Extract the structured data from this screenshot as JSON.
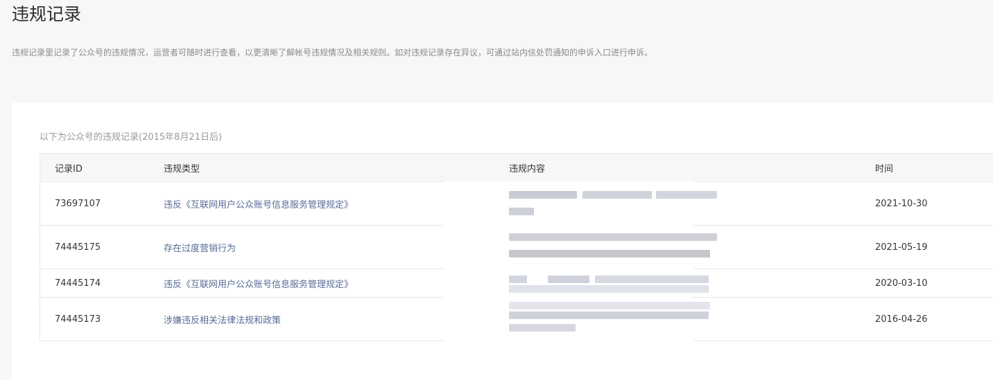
{
  "page": {
    "title": "违规记录",
    "description": "违规记录里记录了公众号的违规情况，运营者可随时进行查看，以更清晰了解帐号违规情况及相关规则。如对违规记录存在异议，可通过站内信处罚通知的申诉入口进行申诉。"
  },
  "records": {
    "subtitle": "以下为公众号的违规记录(2015年8月21日后)",
    "columns": {
      "id": "记录ID",
      "type": "违规类型",
      "content": "违规内容",
      "time": "时间"
    },
    "rows": [
      {
        "id": "73697107",
        "type": "违反《互联网用户公众账号信息服务管理规定》",
        "time": "2021-10-30"
      },
      {
        "id": "74445175",
        "type": "存在过度营销行为",
        "time": "2021-05-19"
      },
      {
        "id": "74445174",
        "type": "违反《互联网用户公众账号信息服务管理规定》",
        "time": "2020-03-10"
      },
      {
        "id": "74445173",
        "type": "涉嫌违反相关法律法规和政策",
        "time": "2016-04-26"
      }
    ]
  }
}
